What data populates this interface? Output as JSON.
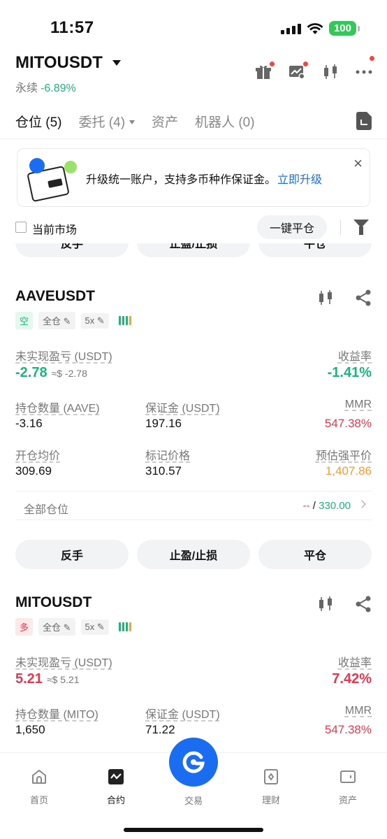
{
  "status": {
    "time": "11:57",
    "battery": "100"
  },
  "header": {
    "pair": "MITOUSDT",
    "market_type": "永续",
    "change": "-6.89%"
  },
  "tabs": {
    "positions": "仓位 (5)",
    "orders": "委托 (4)",
    "assets": "资产",
    "bots": "机器人 (0)"
  },
  "banner": {
    "text": "升级统一账户，支持多币种作保证金。",
    "link": "立即升级",
    "close": "×"
  },
  "filter": {
    "current_market": "当前市场",
    "close_all": "一键平仓"
  },
  "actions": {
    "reverse": "反手",
    "tpsl": "止盈/止损",
    "close": "平仓"
  },
  "positions": [
    {
      "symbol": "AAVEUSDT",
      "side": "空",
      "margin_mode": "全仓",
      "leverage": "5x",
      "pnl_label": "未实现盈亏 (USDT)",
      "pnl": "-2.78",
      "pnl_usd": "≈$ -2.78",
      "roi_label": "收益率",
      "roi": "-1.41%",
      "size_label": "持仓数量 (AAVE)",
      "size": "-3.16",
      "margin_label": "保证金 (USDT)",
      "margin": "197.16",
      "mmr_label": "MMR",
      "mmr": "547.38%",
      "entry_label": "开仓均价",
      "entry": "309.69",
      "mark_label": "标记价格",
      "mark": "310.57",
      "liq_label": "预估强平价",
      "liq": "1,407.86",
      "all_positions_label": "全部仓位",
      "all_positions_left": "--",
      "all_positions_sep": "/",
      "all_positions_right": "330.00"
    },
    {
      "symbol": "MITOUSDT",
      "side": "多",
      "margin_mode": "全仓",
      "leverage": "5x",
      "pnl_label": "未实现盈亏 (USDT)",
      "pnl": "5.21",
      "pnl_usd": "≈$ 5.21",
      "roi_label": "收益率",
      "roi": "7.42%",
      "size_label": "持仓数量 (MITO)",
      "size": "1,650",
      "margin_label": "保证金 (USDT)",
      "margin": "71.22",
      "mmr_label": "MMR",
      "mmr": "547.38%"
    }
  ],
  "nav": {
    "home": "首页",
    "futures": "合约",
    "trade": "交易",
    "earn": "理财",
    "assets": "资产"
  },
  "colors": {
    "green": "#21b27d",
    "red": "#e8384f",
    "orange": "#f39a3c",
    "brand": "#1a6df0"
  }
}
